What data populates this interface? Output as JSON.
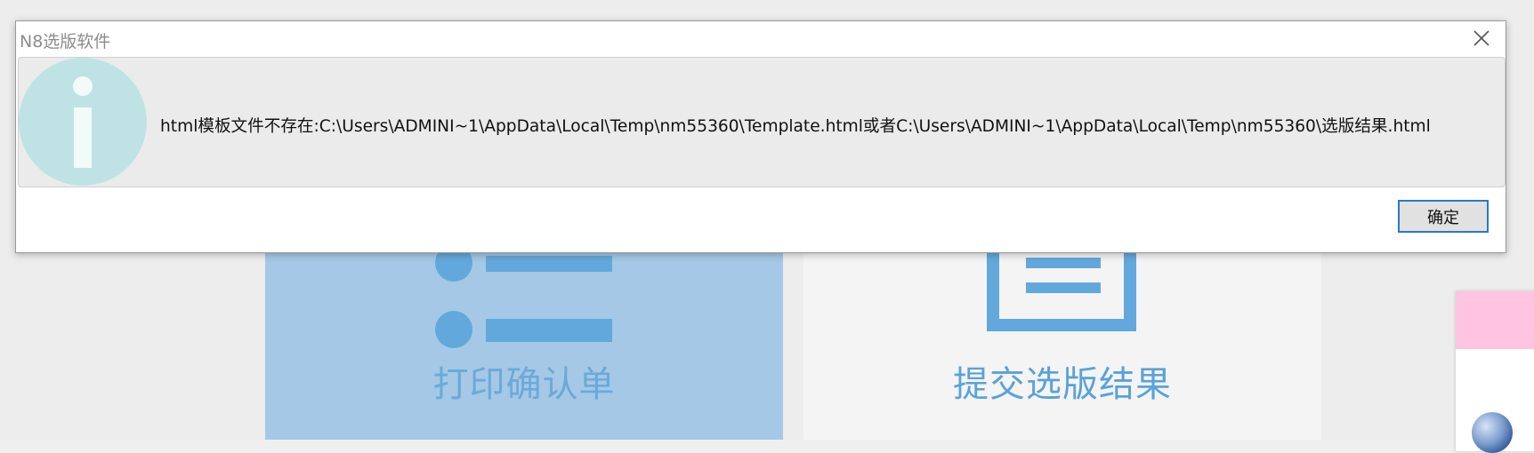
{
  "background": {
    "tiles": [
      {
        "label": "打印确认单",
        "icon": "list-icon"
      },
      {
        "label": "提交选版结果",
        "icon": "document-icon"
      }
    ]
  },
  "dialog": {
    "title": "N8选版软件",
    "icon": "info-icon",
    "close_icon": "close-icon",
    "message": "html模板文件不存在:C:\\Users\\ADMINI~1\\AppData\\Local\\Temp\\nm55360\\Template.html或者C:\\Users\\ADMINI~1\\AppData\\Local\\Temp\\nm55360\\选版结果.html",
    "ok_label": "确定"
  },
  "colors": {
    "accent_blue": "#5aa2d8",
    "info_icon": "#bfe3e4",
    "side_card_header": "#ffc4e2",
    "button_focus_border": "#2b79c8"
  }
}
